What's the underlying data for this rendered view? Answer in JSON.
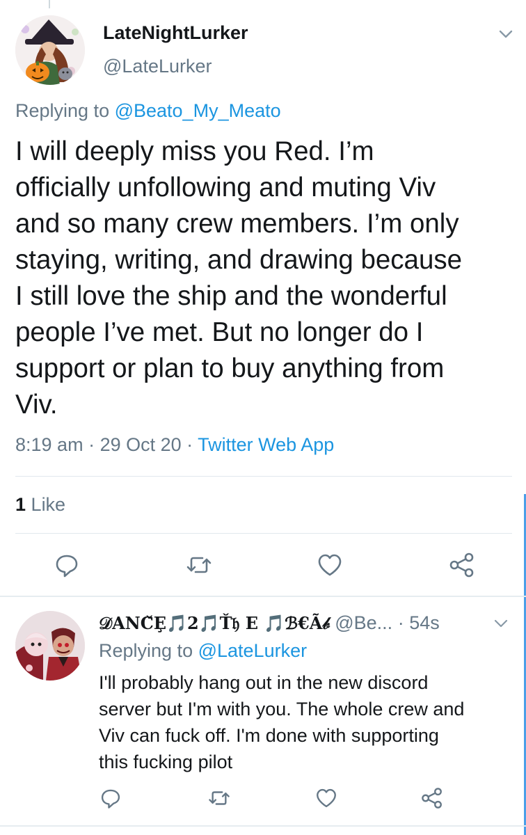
{
  "main_tweet": {
    "display_name": "LateNightLurker",
    "handle": "@LateLurker",
    "replying_prefix": "Replying to ",
    "replying_to": "@Beato_My_Meato",
    "body_lines": [
      "I will deeply miss you Red. I’m",
      "officially unfollowing and muting Viv",
      "and so many crew members. I’m only",
      "staying, writing, and drawing because",
      "I still love the ship and the wonderful",
      "people I’ve met. But no longer do I",
      "support or plan to buy anything from",
      "Viv."
    ],
    "time": "8:19 am",
    "date": "29 Oct 20",
    "source": "Twitter Web App",
    "like_count": "1",
    "like_label": "Like"
  },
  "reply_tweet": {
    "display_name": "𝒟AN𝐂̌Ȩ🎵2🎵Ť𝔥 E 🎵ℬ€Ã𝒷",
    "handle": "@Be...",
    "time_ago": "54s",
    "replying_prefix": "Replying to ",
    "replying_to": "@LateLurker",
    "body_lines": [
      "I'll probably hang out in the new discord",
      "server but I'm with you. The whole crew and",
      "Viv can fuck off. I'm done with supporting",
      "this fucking pilot"
    ]
  },
  "icons": {
    "caret": "chevron-down-icon",
    "reply": "reply-icon",
    "retweet": "retweet-icon",
    "like": "heart-icon",
    "share": "share-icon"
  },
  "colors": {
    "text": "#14171a",
    "secondary": "#657786",
    "link": "#1b95e0",
    "icon": "#657786",
    "divider": "#e1e8ed",
    "scroll_indicator": "#4a9fe8"
  }
}
